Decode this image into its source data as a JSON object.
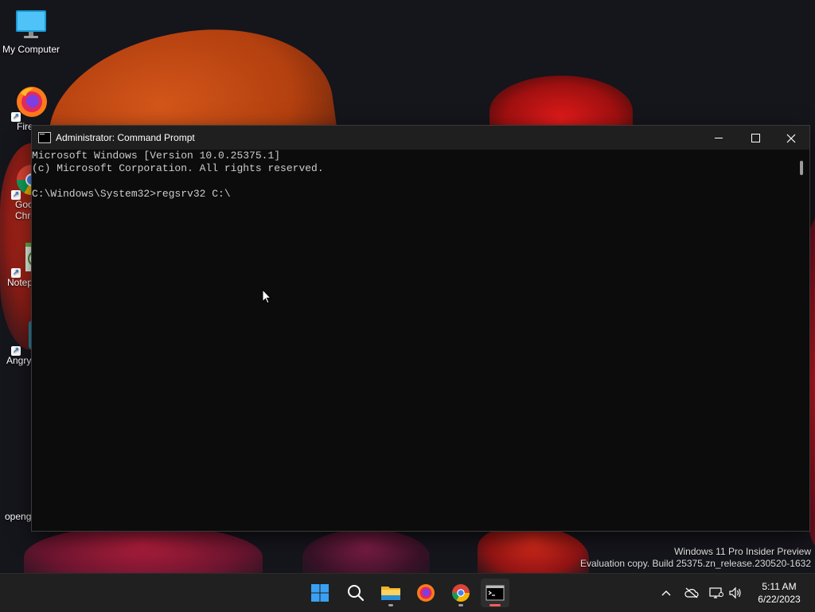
{
  "desktop": {
    "icons": [
      {
        "label": "My Computer",
        "icon": "monitor-icon"
      },
      {
        "label": "Fire",
        "icon": "firefox-icon"
      },
      {
        "label": "Goo",
        "label2": "Chro",
        "icon": "chrome-icon"
      },
      {
        "label": "Notep",
        "icon": "notepad-icon"
      },
      {
        "label": "Angry",
        "icon": "angry-birds-icon"
      },
      {
        "label": "openg",
        "icon": "opengl-icon"
      }
    ],
    "watermark": {
      "line1": "Windows 11 Pro Insider Preview",
      "line2": "Evaluation copy. Build 25375.zn_release.230520-1632"
    }
  },
  "cmd_window": {
    "title": "Administrator: Command Prompt",
    "lines": [
      "Microsoft Windows [Version 10.0.25375.1]",
      "(c) Microsoft Corporation. All rights reserved.",
      "",
      "C:\\Windows\\System32>regsrv32 C:\\"
    ],
    "buttons": {
      "minimize": "minimize-icon",
      "maximize": "maximize-icon",
      "close": "close-icon"
    }
  },
  "taskbar": {
    "items": [
      {
        "name": "start-button",
        "icon": "windows-logo-icon"
      },
      {
        "name": "search-button",
        "icon": "search-icon"
      },
      {
        "name": "file-explorer",
        "icon": "folder-icon"
      },
      {
        "name": "firefox",
        "icon": "firefox-icon"
      },
      {
        "name": "chrome",
        "icon": "chrome-icon"
      },
      {
        "name": "command-prompt",
        "icon": "terminal-icon",
        "active": true
      }
    ],
    "tray": {
      "icons": [
        "chevron-up-icon",
        "cloud-offline-icon",
        "network-icon",
        "volume-icon"
      ],
      "time": "5:11 AM",
      "date": "6/22/2023"
    }
  },
  "colors": {
    "terminal_bg": "#0c0c0c",
    "terminal_text": "#cccccc",
    "taskbar_bg": "#202020",
    "active_indicator": "#f35c5c"
  }
}
